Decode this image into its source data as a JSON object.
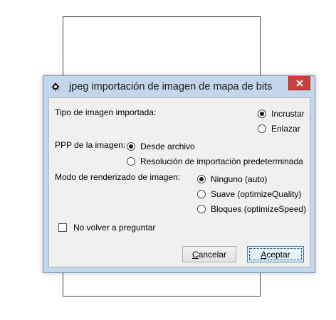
{
  "dialog": {
    "title": "jpeg importación de imagen de mapa de bits",
    "app_icon": "inkscape-icon",
    "close_icon": "close-icon"
  },
  "image_type": {
    "label": "Tipo de imagen importada:",
    "options": [
      {
        "label": "Incrustar",
        "selected": true
      },
      {
        "label": "Enlazar",
        "selected": false
      }
    ]
  },
  "dpi": {
    "label": "PPP de la imagen:",
    "options": [
      {
        "label": "Desde archivo",
        "selected": true
      },
      {
        "label": "Resolución de importación predeterminada",
        "selected": false
      }
    ]
  },
  "render_mode": {
    "label": "Modo de renderizado de imagen:",
    "options": [
      {
        "label": "Ninguno (auto)",
        "selected": true
      },
      {
        "label": "Suave (optimizeQuality)",
        "selected": false
      },
      {
        "label": "Bloques (optimizeSpeed)",
        "selected": false
      }
    ]
  },
  "dont_ask": {
    "label": "No volver a preguntar",
    "checked": false
  },
  "buttons": {
    "cancel_first": "C",
    "cancel_rest": "ancelar",
    "accept_first": "A",
    "accept_rest": "ceptar"
  }
}
